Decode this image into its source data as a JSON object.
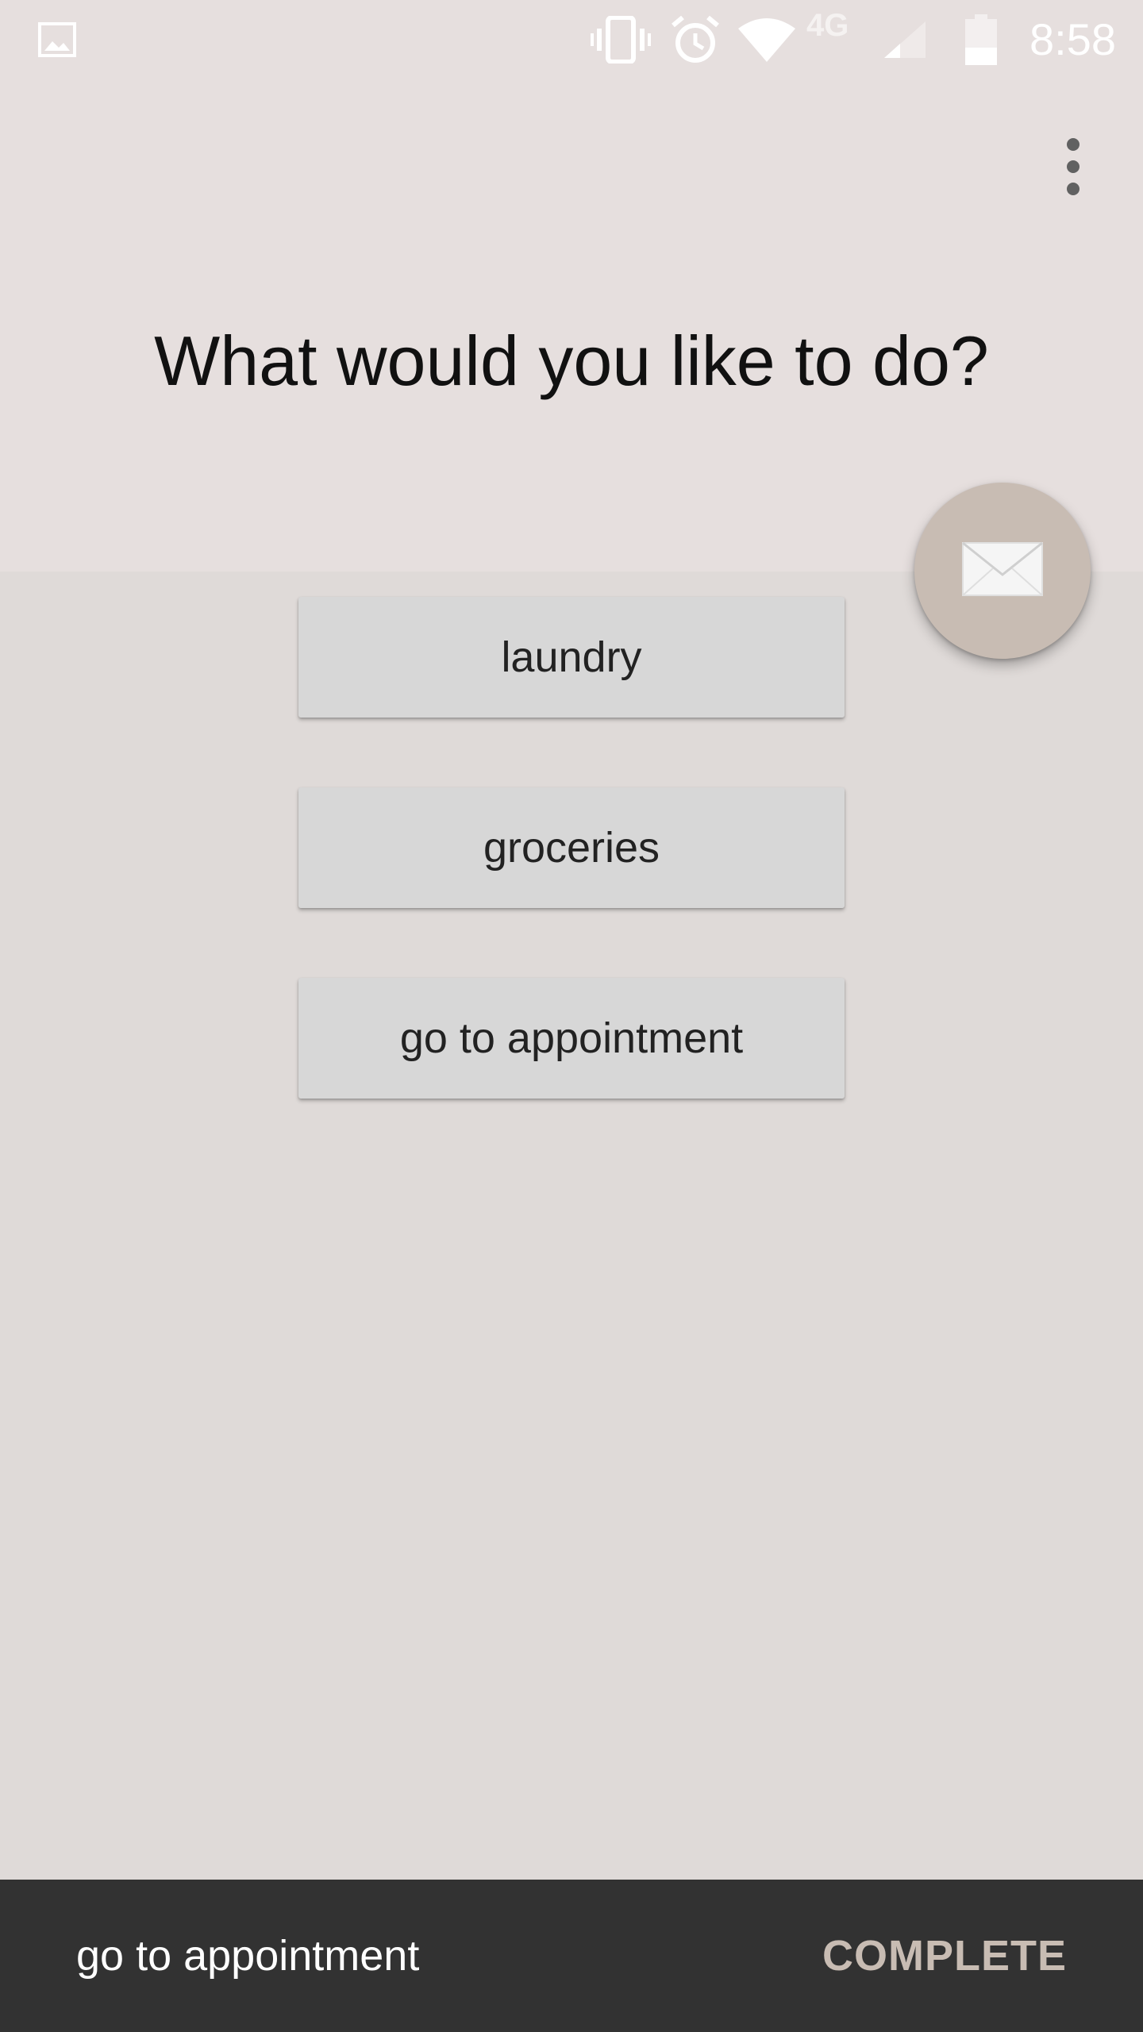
{
  "status_bar": {
    "time": "8:58",
    "network_label": "4G",
    "icons": [
      "image-notification-icon",
      "vibrate-icon",
      "alarm-icon",
      "wifi-icon",
      "cell-signal-icon",
      "battery-icon"
    ]
  },
  "header": {
    "title": "What would you like to do?",
    "menu_icon": "overflow-menu-icon"
  },
  "fab": {
    "icon": "mail-icon"
  },
  "options": [
    {
      "label": "laundry"
    },
    {
      "label": "groceries"
    },
    {
      "label": "go to appointment"
    }
  ],
  "snackbar": {
    "message": "go to appointment",
    "action_label": "COMPLETE"
  },
  "colors": {
    "header_bg": "#e6dfde",
    "body_bg": "#dfdad8",
    "fab": "#c8bcb3",
    "button_bg": "#d7d7d7",
    "snackbar_bg": "#323232",
    "snackbar_action": "#c8bcb3"
  }
}
